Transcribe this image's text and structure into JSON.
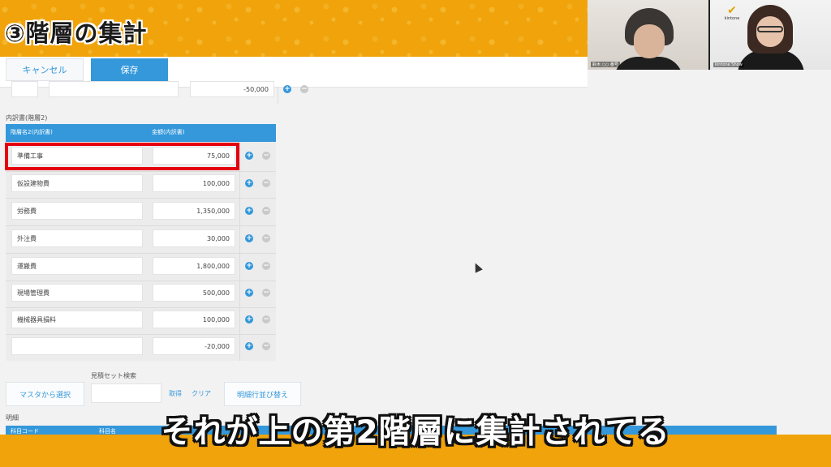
{
  "banner": {
    "title": "③階層の集計"
  },
  "video": {
    "participant1_name": "鈴木 ○○ 番号",
    "participant2_name": "kintone Show",
    "logo_text": "kintone"
  },
  "toolbar": {
    "cancel_label": "キャンセル",
    "save_label": "保存"
  },
  "top_row": {
    "amount": "-50,000"
  },
  "breakdown": {
    "section_label": "内訳書(階層2)",
    "col_name": "階層名2(内訳書)",
    "col_amount": "金額(内訳書)",
    "rows": [
      {
        "name": "準備工事",
        "amount": "75,000"
      },
      {
        "name": "仮設建物費",
        "amount": "100,000"
      },
      {
        "name": "労務費",
        "amount": "1,350,000"
      },
      {
        "name": "外注費",
        "amount": "30,000"
      },
      {
        "name": "運搬費",
        "amount": "1,800,000"
      },
      {
        "name": "現場管理費",
        "amount": "500,000"
      },
      {
        "name": "機械器具損料",
        "amount": "100,000"
      },
      {
        "name": "",
        "amount": "-20,000"
      }
    ]
  },
  "estimate": {
    "search_label": "見積セット検索",
    "master_button": "マスタから選択",
    "get_link": "取得",
    "clear_link": "クリア",
    "sort_button": "明細行並び替え"
  },
  "detail": {
    "section_label": "明細",
    "col1": "科目コード",
    "col2": "科目名"
  },
  "caption": {
    "text": "それが上の第2階層に集計されてる"
  },
  "colors": {
    "accent": "#3498db",
    "banner": "#f0a30a",
    "highlight": "#e5000f"
  }
}
